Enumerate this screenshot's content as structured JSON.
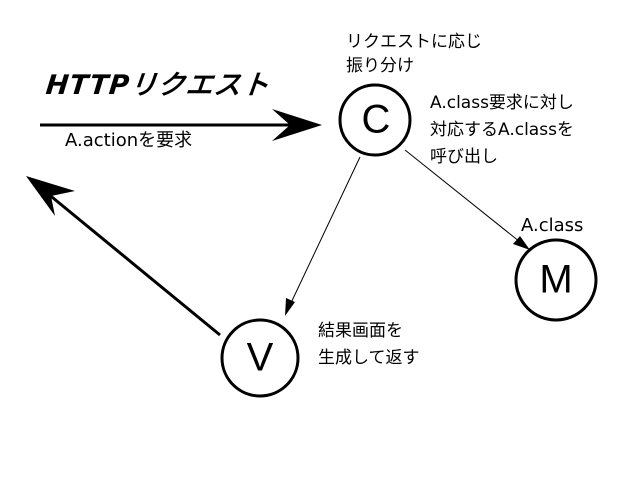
{
  "header": {
    "http_request": "HTTPリクエスト",
    "action_request": "A.actionを要求"
  },
  "controller": {
    "letter": "C",
    "dispatch_line1": "リクエストに応じ",
    "dispatch_line2": "振り分け",
    "call_line1": "A.class要求に対し",
    "call_line2": "対応するA.classを",
    "call_line3": "呼び出し"
  },
  "model": {
    "letter": "M",
    "class_label": "A.class"
  },
  "view": {
    "letter": "V",
    "result_line1": "結果画面を",
    "result_line2": "生成して返す"
  }
}
